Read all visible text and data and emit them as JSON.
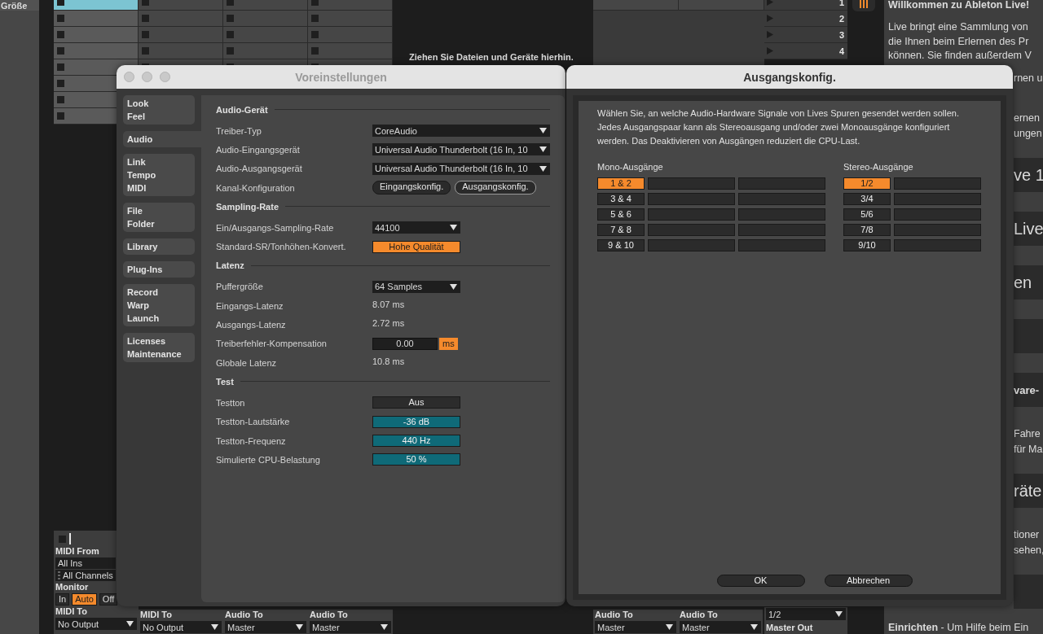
{
  "browser": {
    "label": "Größe"
  },
  "clip_columns": [
    {
      "slots": [
        {
          "selected": true
        },
        {
          "selected": false
        },
        {
          "selected": false
        },
        {
          "selected": false
        },
        {
          "selected": false
        },
        {
          "selected": false
        },
        {
          "selected": false
        },
        {
          "selected": false
        }
      ]
    },
    {
      "slots": [
        {
          "selected": false
        },
        {
          "selected": false
        },
        {
          "selected": false
        },
        {
          "selected": false
        },
        {
          "selected": false
        }
      ]
    },
    {
      "slots": [
        {
          "selected": false
        },
        {
          "selected": false
        },
        {
          "selected": false
        },
        {
          "selected": false
        },
        {
          "selected": false
        }
      ]
    },
    {
      "slots": [
        {
          "selected": false
        },
        {
          "selected": false
        },
        {
          "selected": false
        },
        {
          "selected": false
        },
        {
          "selected": false
        }
      ]
    }
  ],
  "drop_hint": "Ziehen Sie Dateien und Geräte hierhin.",
  "scenes": [
    "1",
    "2",
    "3",
    "4"
  ],
  "midi_track": {
    "input_label": "MIDI From",
    "input": "All Ins",
    "channel": "All Channels",
    "monitor_label": "Monitor",
    "monitor": [
      {
        "label": "In",
        "selected": false
      },
      {
        "label": "Auto",
        "selected": true
      },
      {
        "label": "Off",
        "selected": false
      }
    ],
    "output_label": "MIDI To",
    "output": "No Output"
  },
  "track_outputs": [
    {
      "label": "MIDI To",
      "value": "No Output"
    },
    {
      "label": "Audio To",
      "value": "Master"
    },
    {
      "label": "Audio To",
      "value": "Master"
    }
  ],
  "return_outputs": [
    {
      "label": "Audio To",
      "value": "Master"
    },
    {
      "label": "Audio To",
      "value": "Master"
    }
  ],
  "master": {
    "output": "1/2",
    "label": "Master Out"
  },
  "welcome": {
    "title": "Willkommen zu Ableton Live!",
    "lines": [
      "Live bringt eine Sammlung von",
      "die Ihnen beim Erlernen des Pr",
      "können. Sie finden außerdem V"
    ],
    "fragments": [
      {
        "kind": "paragraph",
        "lines": [
          "rnen u"
        ]
      },
      {
        "kind": "paragraph",
        "lines": [
          "ernen",
          "ungen"
        ]
      },
      {
        "kind": "tile",
        "text": "ve 1"
      },
      {
        "kind": "tile",
        "text": "Live"
      },
      {
        "kind": "tile",
        "text": "en"
      },
      {
        "kind": "tile"
      },
      {
        "kind": "subtile",
        "text": "vare-"
      },
      {
        "kind": "paragraph",
        "lines": [
          "Fahre",
          "für Ma"
        ]
      },
      {
        "kind": "tile",
        "text": "räte"
      },
      {
        "kind": "paragraph",
        "lines": [
          "tioner",
          "sehen,"
        ]
      },
      {
        "kind": "tile"
      }
    ],
    "footer": "**Einrichten** - Um Hilfe beim Ein"
  },
  "preferences": {
    "title": "Voreinstellungen",
    "tabs": [
      {
        "labels": [
          "Look",
          "Feel"
        ],
        "selected": false
      },
      {
        "labels": [
          "Audio"
        ],
        "selected": true
      },
      {
        "labels": [
          "Link",
          "Tempo",
          "MIDI"
        ],
        "selected": false
      },
      {
        "labels": [
          "File",
          "Folder"
        ],
        "selected": false
      },
      {
        "labels": [
          "Library"
        ],
        "selected": false
      },
      {
        "labels": [
          "Plug-Ins"
        ],
        "selected": false
      },
      {
        "labels": [
          "Record",
          "Warp",
          "Launch"
        ],
        "selected": false
      },
      {
        "labels": [
          "Licenses",
          "Maintenance"
        ],
        "selected": false
      }
    ],
    "sections": [
      {
        "title": "Audio-Gerät",
        "rows": [
          {
            "kind": "combo",
            "label": "Treiber-Typ",
            "value": "CoreAudio"
          },
          {
            "kind": "combo",
            "label": "Audio-Eingangsgerät",
            "value": "Universal Audio Thunderbolt (16 In, 10"
          },
          {
            "kind": "combo",
            "label": "Audio-Ausgangsgerät",
            "value": "Universal Audio Thunderbolt (16 In, 10"
          },
          {
            "kind": "buttons",
            "label": "Kanal-Konfiguration",
            "buttons": [
              {
                "label": "Eingangskonfig.",
                "selected": false
              },
              {
                "label": "Ausgangskonfig.",
                "selected": true
              }
            ]
          }
        ]
      },
      {
        "title": "Sampling-Rate",
        "rows": [
          {
            "kind": "dropdown",
            "label": "Ein/Ausgangs-Sampling-Rate",
            "value": "44100"
          },
          {
            "kind": "toggle",
            "label": "Standard-SR/Tonhöhen-Konvert.",
            "value": "Hohe Qualität",
            "on": true
          }
        ]
      },
      {
        "title": "Latenz",
        "rows": [
          {
            "kind": "dropdown",
            "label": "Puffergröße",
            "value": "64 Samples"
          },
          {
            "kind": "text",
            "label": "Eingangs-Latenz",
            "value": "8.07 ms"
          },
          {
            "kind": "text",
            "label": "Ausgangs-Latenz",
            "value": "2.72 ms"
          },
          {
            "kind": "number",
            "label": "Treiberfehler-Kompensation",
            "value": "0.00",
            "unit": "ms"
          },
          {
            "kind": "text",
            "label": "Globale Latenz",
            "value": "10.8 ms"
          }
        ]
      },
      {
        "title": "Test",
        "rows": [
          {
            "kind": "toggle",
            "label": "Testton",
            "value": "Aus",
            "on": false
          },
          {
            "kind": "value",
            "label": "Testton-Lautstärke",
            "value": "-36 dB"
          },
          {
            "kind": "value",
            "label": "Testton-Frequenz",
            "value": "440 Hz"
          },
          {
            "kind": "value",
            "label": "Simulierte CPU-Belastung",
            "value": "50 %"
          }
        ]
      }
    ]
  },
  "output_config": {
    "title": "Ausgangskonfig.",
    "description": "Wählen Sie, an welche Audio-Hardware Signale von Lives Spuren gesendet werden sollen. Jedes Ausgangspaar kann als Stereoausgang und/oder zwei Monoausgänge konfiguriert werden. Das Deaktivieren von Ausgängen reduziert die CPU-Last.",
    "mono_header": "Mono-Ausgänge",
    "stereo_header": "Stereo-Ausgänge",
    "mono": [
      {
        "label": "1 & 2",
        "selected": true
      },
      {
        "label": "3 & 4",
        "selected": false
      },
      {
        "label": "5 & 6",
        "selected": false
      },
      {
        "label": "7 & 8",
        "selected": false
      },
      {
        "label": "9 & 10",
        "selected": false
      }
    ],
    "stereo": [
      {
        "label": "1/2",
        "selected": true
      },
      {
        "label": "3/4",
        "selected": false
      },
      {
        "label": "5/6",
        "selected": false
      },
      {
        "label": "7/8",
        "selected": false
      },
      {
        "label": "9/10",
        "selected": false
      }
    ],
    "buttons": [
      "OK",
      "Abbrechen"
    ]
  }
}
